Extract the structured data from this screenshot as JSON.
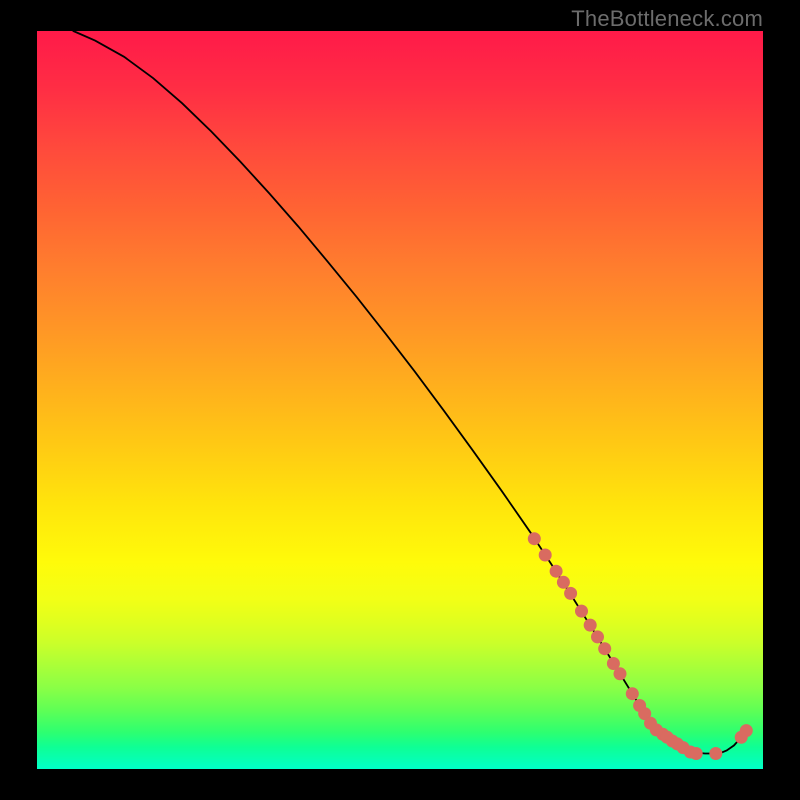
{
  "watermark": "TheBottleneck.com",
  "chart_data": {
    "type": "line",
    "title": "",
    "xlabel": "",
    "ylabel": "",
    "xlim": [
      0,
      100
    ],
    "ylim": [
      0,
      100
    ],
    "grid": false,
    "legend": false,
    "series": [
      {
        "name": "curve",
        "style": "line",
        "color": "#000000",
        "x": [
          5,
          8,
          12,
          16,
          20,
          24,
          28,
          32,
          36,
          40,
          44,
          48,
          52,
          56,
          60,
          64,
          68,
          71,
          74,
          77,
          80,
          82,
          84,
          86,
          88,
          90,
          92,
          94,
          95,
          96,
          97,
          98
        ],
        "values": [
          100,
          98.7,
          96.5,
          93.6,
          90.2,
          86.4,
          82.3,
          78.0,
          73.5,
          68.8,
          64.0,
          59.0,
          53.9,
          48.6,
          43.2,
          37.7,
          32.0,
          27.5,
          22.9,
          18.2,
          13.4,
          10.2,
          7.0,
          4.7,
          3.1,
          2.3,
          2.1,
          2.1,
          2.5,
          3.2,
          4.3,
          5.6
        ]
      },
      {
        "name": "markers",
        "style": "scatter",
        "color": "#d96b60",
        "x": [
          68.5,
          70.0,
          71.5,
          72.5,
          73.5,
          75.0,
          76.2,
          77.2,
          78.2,
          79.4,
          80.3,
          82.0,
          83.0,
          83.7,
          84.5,
          85.3,
          86.2,
          86.8,
          87.5,
          88.2,
          89.0,
          90.0,
          90.8,
          93.5,
          97.0,
          97.7
        ],
        "values": [
          31.2,
          29.0,
          26.8,
          25.3,
          23.8,
          21.4,
          19.5,
          17.9,
          16.3,
          14.3,
          12.9,
          10.2,
          8.6,
          7.5,
          6.2,
          5.3,
          4.7,
          4.3,
          3.8,
          3.4,
          2.9,
          2.3,
          2.1,
          2.1,
          4.3,
          5.2
        ]
      }
    ],
    "background_gradient": {
      "top_color": "#ff1a49",
      "bottom_color": "#00ffc8"
    }
  }
}
